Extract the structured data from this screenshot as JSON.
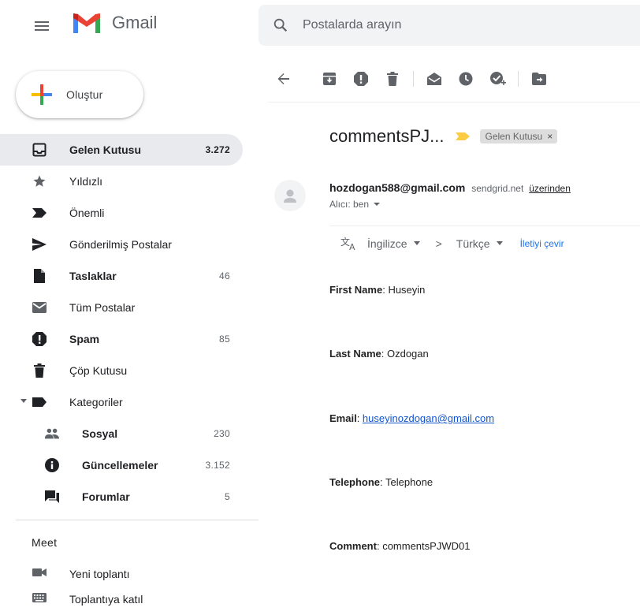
{
  "header": {
    "app_name": "Gmail",
    "search_placeholder": "Postalarda arayın"
  },
  "sidebar": {
    "compose_label": "Oluştur",
    "items": [
      {
        "label": "Gelen Kutusu",
        "count": "3.272",
        "icon": "inbox-icon",
        "active": true,
        "bold": true
      },
      {
        "label": "Yıldızlı",
        "count": "",
        "icon": "star-icon"
      },
      {
        "label": "Önemli",
        "count": "",
        "icon": "important-icon"
      },
      {
        "label": "Gönderilmiş Postalar",
        "count": "",
        "icon": "send-icon"
      },
      {
        "label": "Taslaklar",
        "count": "46",
        "icon": "draft-icon",
        "bold": true
      },
      {
        "label": "Tüm Postalar",
        "count": "",
        "icon": "mail-icon"
      },
      {
        "label": "Spam",
        "count": "85",
        "icon": "spam-icon",
        "bold": true
      },
      {
        "label": "Çöp Kutusu",
        "count": "",
        "icon": "trash-icon"
      },
      {
        "label": "Kategoriler",
        "count": "",
        "icon": "label-icon"
      }
    ],
    "categories": [
      {
        "label": "Sosyal",
        "count": "230",
        "icon": "people-icon"
      },
      {
        "label": "Güncellemeler",
        "count": "3.152",
        "icon": "info-icon"
      },
      {
        "label": "Forumlar",
        "count": "5",
        "icon": "forum-icon"
      }
    ],
    "meet": {
      "title": "Meet",
      "items": [
        {
          "label": "Yeni toplantı",
          "icon": "videocam-icon"
        },
        {
          "label": "Toplantıya katıl",
          "icon": "keyboard-icon"
        }
      ]
    }
  },
  "message": {
    "subject": "commentsPJ...",
    "label_chip": "Gelen Kutusu",
    "label_close": "×",
    "sender_email": "hozdogan588@gmail.com",
    "via_domain": "sendgrid.net",
    "via_link": "üzerinden",
    "to_line": "Alıcı: ben",
    "translate": {
      "from_lang": "İngilizce",
      "arrow": ">",
      "to_lang": "Türkçe",
      "action": "İletiyi çevir"
    },
    "fields": [
      {
        "key": "First Name",
        "value": "Huseyin",
        "link": false
      },
      {
        "key": "Last Name",
        "value": "Ozdogan",
        "link": false
      },
      {
        "key": "Email",
        "value": "huseyinozdogan@gmail.com",
        "link": true
      },
      {
        "key": "Telephone",
        "value": "Telephone",
        "link": false
      },
      {
        "key": "Comment",
        "value": "commentsPJWD01",
        "link": false
      }
    ],
    "separator": ": "
  }
}
